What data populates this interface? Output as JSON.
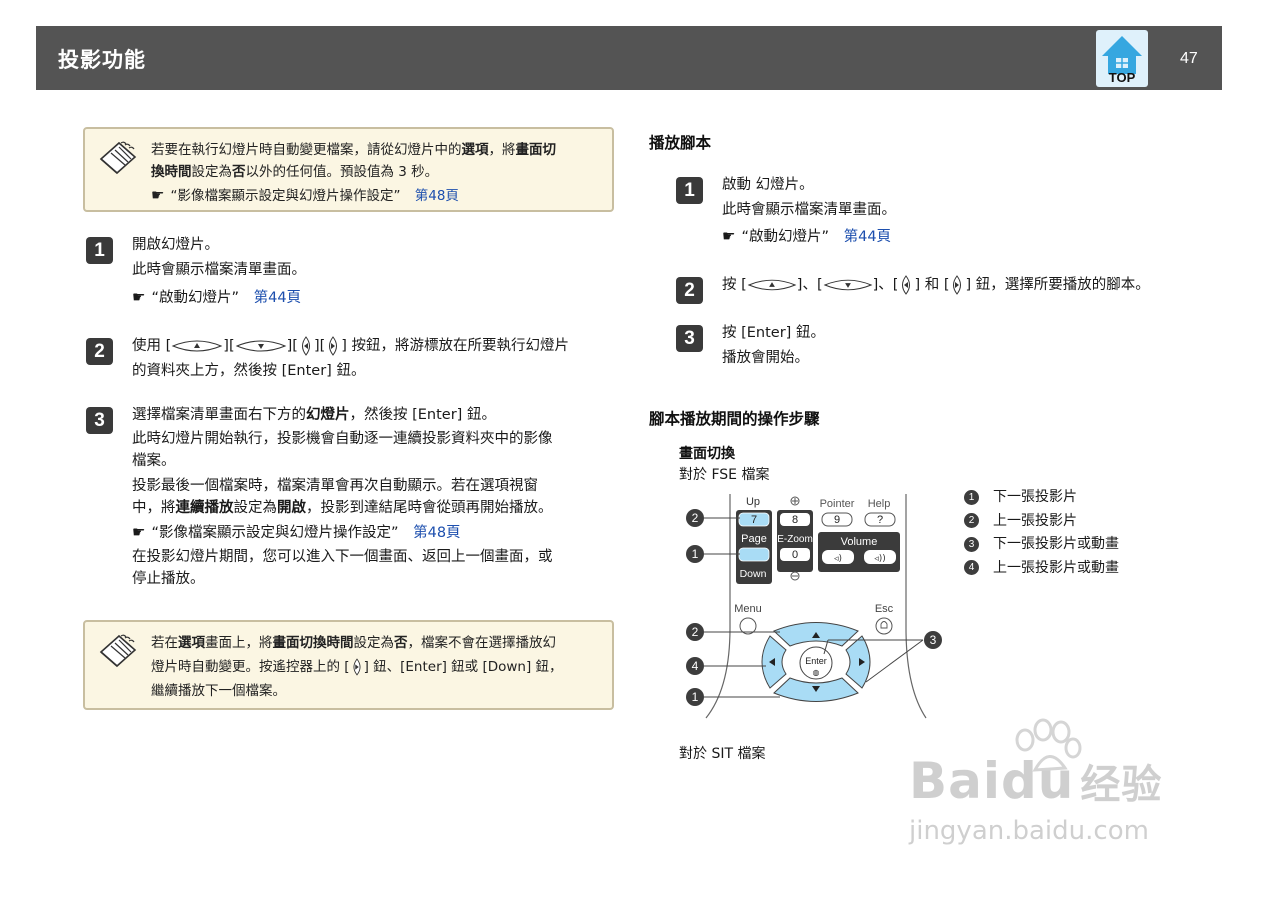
{
  "header": {
    "title": "投影功能",
    "top_label": "TOP",
    "page_number": "47"
  },
  "note1": {
    "line1": [
      "若要在執行幻燈片時自動變更檔案，請從幻燈片中的",
      "選項",
      "，將",
      "畫面切"
    ],
    "line2": [
      "換時間",
      "設定為",
      "否",
      "以外的任何值。預設值為 3 秒。"
    ],
    "ref_text": "“影像檔案顯示設定與幻燈片操作設定”",
    "ref_page": "第48頁"
  },
  "left_steps": {
    "s1": {
      "num": "1",
      "line1": "開啟幻燈片。",
      "line2": "此時會顯示檔案清單畫面。",
      "ref_text": "“啟動幻燈片”",
      "ref_page": "第44頁"
    },
    "s2": {
      "num": "2",
      "use": "使用",
      "after_keys": "按鈕，將游標放在所要執行幻燈片",
      "line2": "的資料夾上方，然後按 [Enter] 鈕。"
    },
    "s3": {
      "num": "3",
      "line1": [
        "選擇檔案清單畫面右下方的",
        "幻燈片",
        "，然後按 [Enter] 鈕。"
      ],
      "line2": "此時幻燈片開始執行，投影機會自動逐一連續投影資料夾中的影像",
      "line3": "檔案。",
      "line4": "投影最後一個檔案時，檔案清單會再次自動顯示。若在選項視窗",
      "line5": [
        "中，將",
        "連續播放",
        "設定為",
        "開啟",
        "，投影到達結尾時會從頭再開始播放。"
      ],
      "ref_text": "“影像檔案顯示設定與幻燈片操作設定”",
      "ref_page": "第48頁",
      "line6": "在投影幻燈片期間，您可以進入下一個畫面、返回上一個畫面，或",
      "line7": "停止播放。"
    }
  },
  "note2": {
    "line1": [
      "若在",
      "選項",
      "畫面上，將",
      "畫面切換時間",
      "設定為",
      "否",
      "，檔案不會在選擇播放幻"
    ],
    "line2a": "燈片時自動變更。按遙控器上的 [",
    "line2b": "] 鈕、[Enter] 鈕或 [Down] 鈕，",
    "line3": "繼續播放下一個檔案。"
  },
  "right": {
    "section1": "播放腳本",
    "s1": {
      "num": "1",
      "line1": "啟動 幻燈片。",
      "line2": "此時會顯示檔案清單畫面。",
      "ref_text": "“啟動幻燈片”",
      "ref_page": "第44頁"
    },
    "s2": {
      "num": "2",
      "press": "按",
      "sep1": "]、[",
      "sep2": "]、[",
      "and": "] 和 [",
      "tail": "] 鈕，選擇所要播放的腳本。"
    },
    "s3": {
      "num": "3",
      "line1": "按 [Enter] 鈕。",
      "line2": "播放會開始。"
    },
    "section2": "腳本播放期間的操作步驟",
    "sub": "畫面切換",
    "fse": "對於 FSE 檔案",
    "sit": "對於 SIT 檔案"
  },
  "remote": {
    "up": "Up",
    "page": "Page",
    "down": "Down",
    "seven": "7",
    "eight": "8",
    "zero": "0",
    "ezoom": "E-Zoom",
    "pointer": "Pointer",
    "help": "Help",
    "nine": "9",
    "q": "?",
    "volume": "Volume",
    "menu": "Menu",
    "esc": "Esc",
    "enter": "Enter",
    "c1": "1",
    "c2": "2",
    "c3": "3",
    "c4": "4"
  },
  "legend": [
    {
      "num": "1",
      "text": "下一張投影片"
    },
    {
      "num": "2",
      "text": "上一張投影片"
    },
    {
      "num": "3",
      "text": "下一張投影片或動畫"
    },
    {
      "num": "4",
      "text": "上一張投影片或動畫"
    }
  ],
  "watermark": {
    "brand_a": "Bai",
    "brand_b": "du",
    "brand_cn": "经验",
    "url": "jingyan.baidu.com"
  },
  "colors": {
    "header": "#545454",
    "note_bg": "#fbf6e3",
    "link": "#1d4fae",
    "remote_blue": "#a9dcf5"
  }
}
